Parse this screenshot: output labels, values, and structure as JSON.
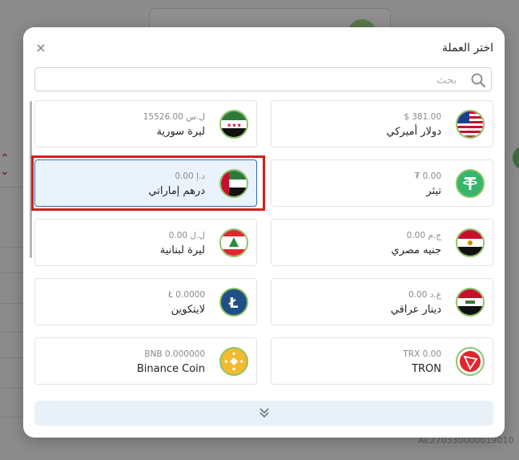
{
  "modal": {
    "title": "اختر العملة",
    "close_icon": "close-icon",
    "search": {
      "placeholder": "بحث",
      "value": "",
      "icon": "search-icon"
    }
  },
  "currencies": [
    {
      "name": "دولار أميركي",
      "rate": "$ 381.00",
      "flag": "usa-flag-icon"
    },
    {
      "name": "ليرة سورية",
      "rate": "15526.00 ل.س",
      "flag": "syria-flag-icon"
    },
    {
      "name": "تيثر",
      "rate": "₮ 0.00",
      "flag": "tether-icon"
    },
    {
      "name": "درهم إماراتي",
      "rate": "0.00 د.إ",
      "flag": "uae-flag-icon",
      "selected": true
    },
    {
      "name": "جنيه مصري",
      "rate": "0.00 ج.م",
      "flag": "egypt-flag-icon"
    },
    {
      "name": "ليرة لبنانية",
      "rate": "0.00 ل.ل",
      "flag": "lebanon-flag-icon"
    },
    {
      "name": "دينار عراقي",
      "rate": "0.00 ع.د",
      "flag": "iraq-flag-icon"
    },
    {
      "name": "لايتكوين",
      "rate": "Ł 0.0000",
      "flag": "litecoin-icon"
    },
    {
      "name": "TRON",
      "rate": "TRX 0.00",
      "flag": "tron-icon"
    },
    {
      "name": "Binance Coin",
      "rate": "BNB 0.000000",
      "flag": "binance-icon"
    }
  ],
  "more_button": {
    "icon": "chevrons-down-icon"
  },
  "background": {
    "iban_partial": "AE270330000019010"
  },
  "colors": {
    "selected_border": "#2f6fb5",
    "selected_bg": "#eaf3fb",
    "highlight": "#d21f1f",
    "flag_ring": "#8fc36a"
  }
}
